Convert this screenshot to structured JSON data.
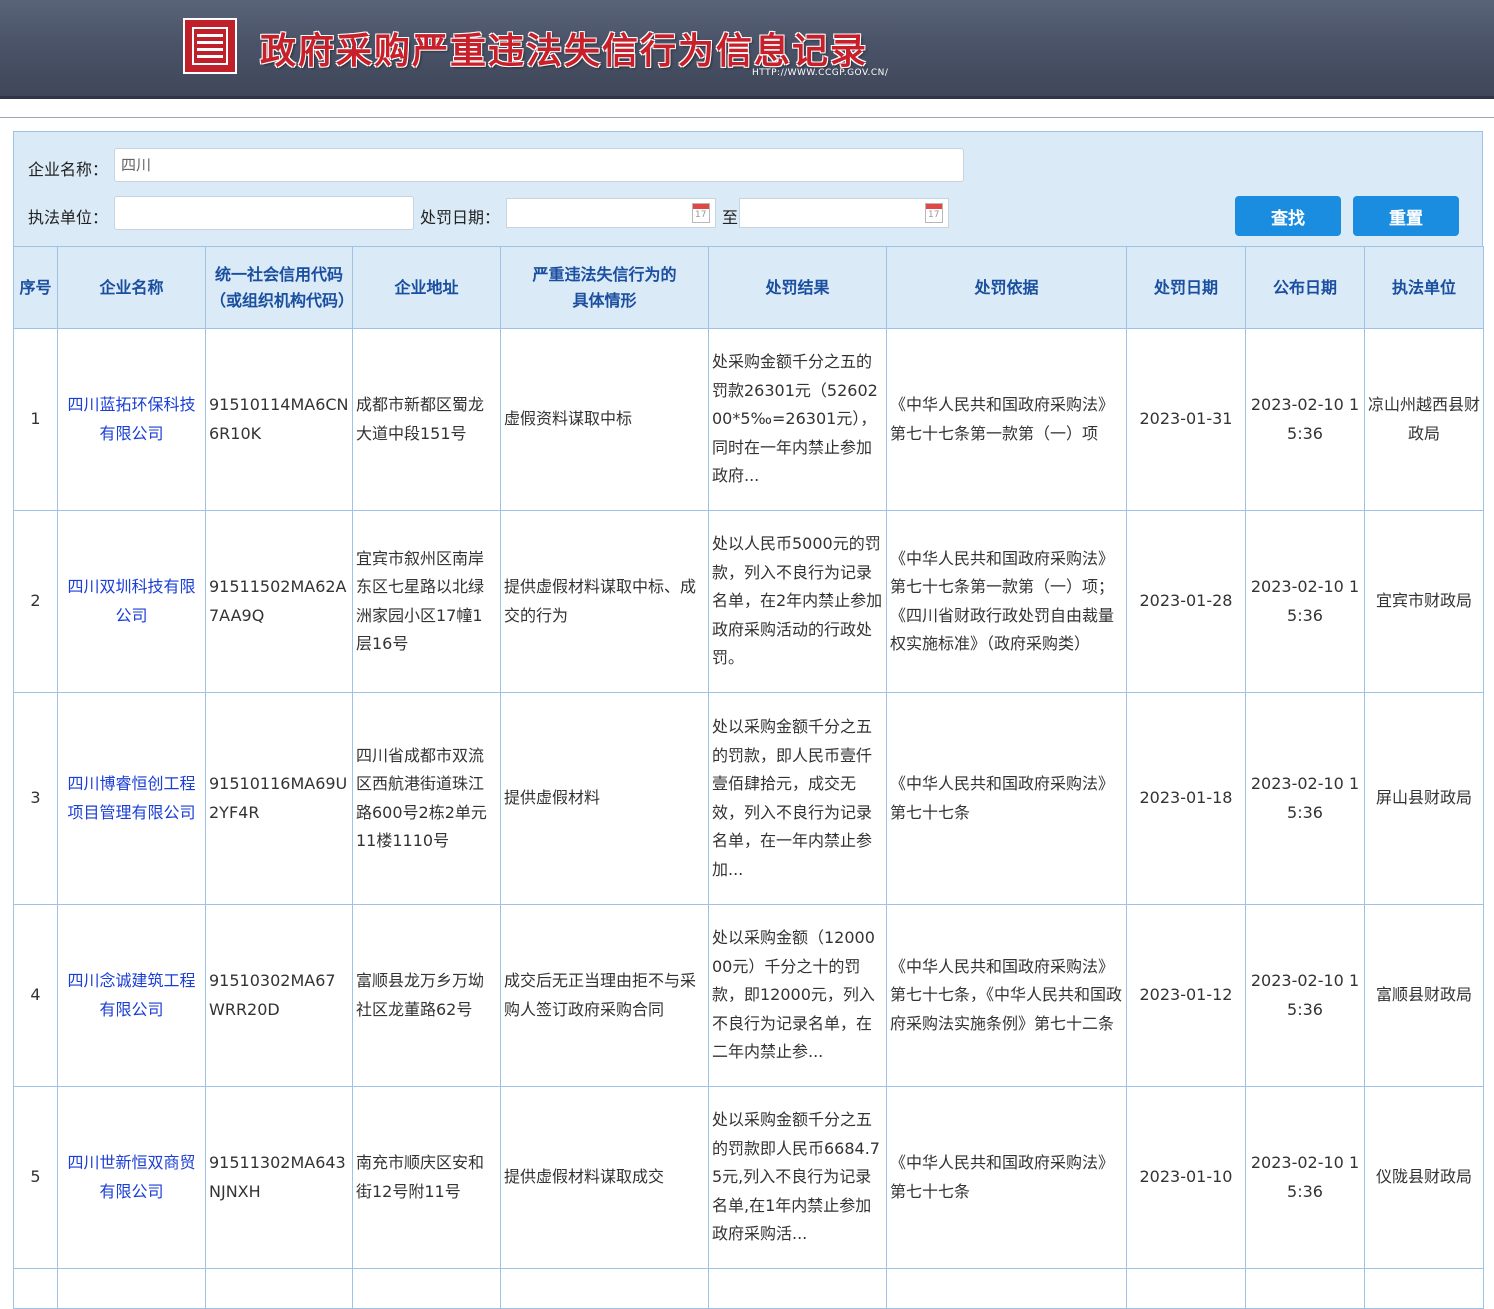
{
  "header": {
    "title": "政府采购严重违法失信行为信息记录",
    "url": "HTTP://WWW.CCGP.GOV.CN/"
  },
  "search": {
    "company_label": "企业名称：",
    "company_value": "四川",
    "enforcer_label": "执法单位：",
    "enforcer_value": "",
    "date_label": "处罚日期：",
    "date_to_label": "至",
    "search_button": "查找",
    "reset_button": "重置"
  },
  "table": {
    "columns": [
      "序号",
      "企业名称",
      "统一社会信用代码（或组织机构代码）",
      "企业地址",
      "严重违法失信行为的具体情形",
      "处罚结果",
      "处罚依据",
      "处罚日期",
      "公布日期",
      "执法单位"
    ],
    "rows": [
      {
        "no": "1",
        "company": "四川蓝拓环保科技有限公司",
        "code": "91510114MA6CN6R10K",
        "address": "成都市新都区蜀龙大道中段151号",
        "situation": "虚假资料谋取中标",
        "result": "处采购金额千分之五的罚款26301元（5260200*5‰=26301元），同时在一年内禁止参加政府...",
        "basis": "《中华人民共和国政府采购法》第七十七条第一款第（一）项",
        "penalty_date": "2023-01-31",
        "publish_date": "2023-02-10 15:36",
        "enforcer": "凉山州越西县财政局"
      },
      {
        "no": "2",
        "company": "四川双圳科技有限公司",
        "code": "91511502MA62A7AA9Q",
        "address": "宜宾市叙州区南岸东区七星路以北绿洲家园小区17幢1层16号",
        "situation": "提供虚假材料谋取中标、成交的行为",
        "result": "处以人民币5000元的罚款，列入不良行为记录名单，在2年内禁止参加政府采购活动的行政处罚。",
        "basis": "《中华人民共和国政府采购法》第七十七条第一款第（一）项；《四川省财政行政处罚自由裁量权实施标准》（政府采购类）",
        "penalty_date": "2023-01-28",
        "publish_date": "2023-02-10 15:36",
        "enforcer": "宜宾市财政局"
      },
      {
        "no": "3",
        "company": "四川博睿恒创工程项目管理有限公司",
        "code": "91510116MA69U2YF4R",
        "address": "四川省成都市双流区西航港街道珠江路600号2栋2单元11楼1110号",
        "situation": "提供虚假材料",
        "result": "处以采购金额千分之五的罚款，即人民币壹仟壹佰肆拾元，成交无效，列入不良行为记录名单，在一年内禁止参加...",
        "basis": "《中华人民共和国政府采购法》第七十七条",
        "penalty_date": "2023-01-18",
        "publish_date": "2023-02-10 15:36",
        "enforcer": "屏山县财政局"
      },
      {
        "no": "4",
        "company": "四川念诚建筑工程有限公司",
        "code": "91510302MA67WRR20D",
        "address": "富顺县龙万乡万坳社区龙董路62号",
        "situation": "成交后无正当理由拒不与采购人签订政府采购合同",
        "result": "处以采购金额（1200000元）千分之十的罚款，即12000元，列入不良行为记录名单，在二年内禁止参...",
        "basis": "《中华人民共和国政府采购法》第七十七条，《中华人民共和国政府采购法实施条例》第七十二条",
        "penalty_date": "2023-01-12",
        "publish_date": "2023-02-10 15:36",
        "enforcer": "富顺县财政局"
      },
      {
        "no": "5",
        "company": "四川世新恒双商贸有限公司",
        "code": "91511302MA643NJNXH",
        "address": "南充市顺庆区安和街12号附11号",
        "situation": "提供虚假材料谋取成交",
        "result": "处以采购金额千分之五的罚款即人民币6684.75元,列入不良行为记录名单,在1年内禁止参加政府采购活...",
        "basis": "《中华人民共和国政府采购法》第七十七条",
        "penalty_date": "2023-01-10",
        "publish_date": "2023-02-10 15:36",
        "enforcer": "仪陇县财政局"
      }
    ]
  }
}
